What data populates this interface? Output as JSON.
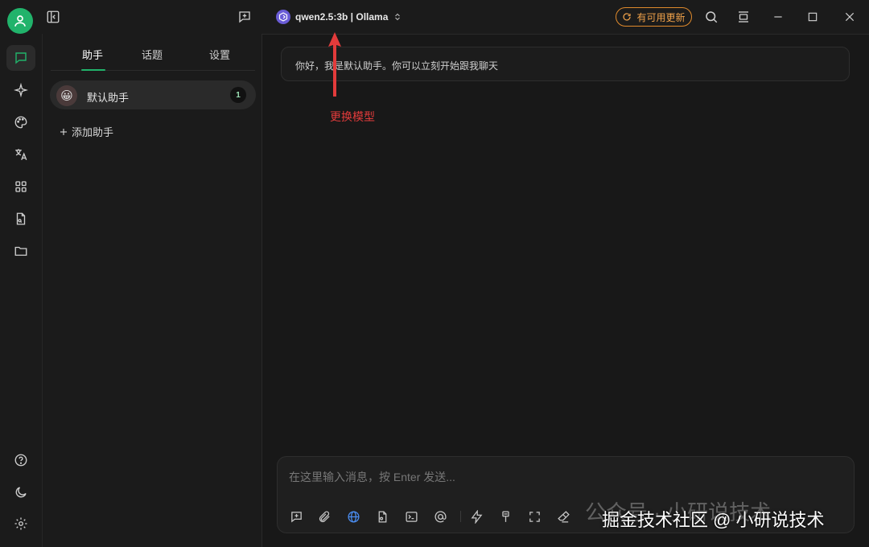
{
  "titlebar": {
    "model_name": "qwen2.5:3b | Ollama",
    "update_label": "有可用更新"
  },
  "panel": {
    "tabs": [
      {
        "label": "助手"
      },
      {
        "label": "话题"
      },
      {
        "label": "设置"
      }
    ],
    "assistant": {
      "emoji": "😀",
      "name": "默认助手",
      "count": "1"
    },
    "add_label": "添加助手"
  },
  "chat": {
    "greeting": "你好，我是默认助手。你可以立刻开始跟我聊天",
    "annotation": "更换模型",
    "input_placeholder": "在这里输入消息，按 Enter 发送..."
  },
  "watermark": {
    "line1": "公众号 · 小研说技术",
    "line2": "掘金技术社区 @ 小研说技术"
  },
  "colors": {
    "accent": "#21b36b",
    "update_border": "#e08a2c",
    "annotation": "#e23b3b",
    "model_logo": "#6a5cd6"
  },
  "icons": {
    "rail": [
      "chat-icon",
      "sparkle-icon",
      "palette-icon",
      "translate-icon",
      "apps-grid-icon",
      "file-search-icon",
      "folder-icon",
      "help-icon",
      "moon-icon",
      "gear-icon"
    ],
    "toolbar": [
      "new-topic-icon",
      "attachment-icon",
      "globe-icon",
      "file-icon",
      "terminal-icon",
      "at-icon",
      "lightning-icon",
      "brush-icon",
      "fullscreen-icon",
      "eraser-icon"
    ]
  }
}
